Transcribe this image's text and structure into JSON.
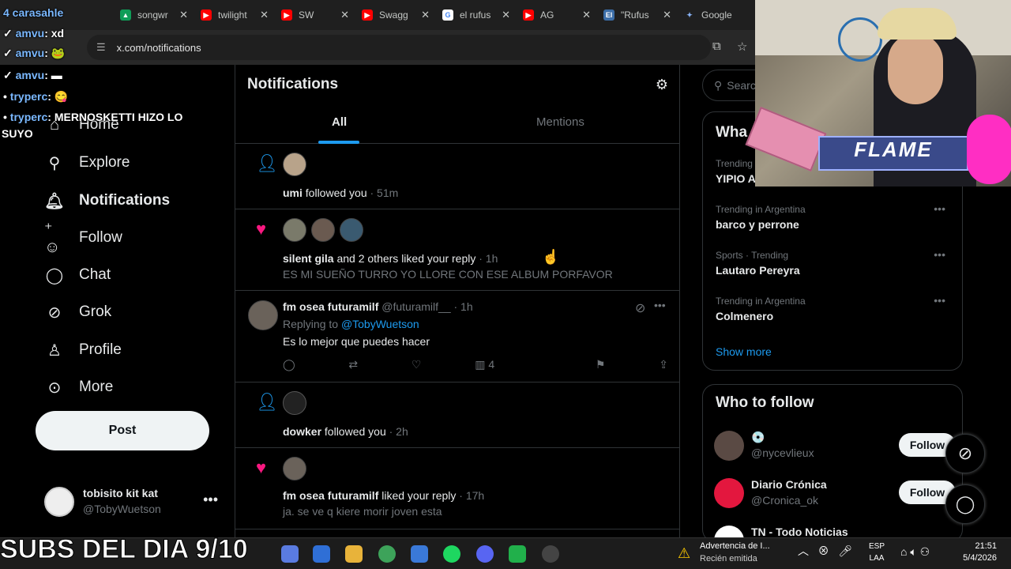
{
  "browser": {
    "tabs": [
      {
        "title": "songwr",
        "icon": "drive-icon",
        "color": "#0f9d58"
      },
      {
        "title": "twilight",
        "icon": "youtube-icon",
        "color": "#ff0000"
      },
      {
        "title": "SW",
        "icon": "youtube-icon",
        "color": "#ff0000"
      },
      {
        "title": "Swagg",
        "icon": "youtube-icon",
        "color": "#ff0000"
      },
      {
        "title": "el rufus",
        "icon": "google-icon",
        "color": "#4285f4"
      },
      {
        "title": "AG",
        "icon": "youtube-icon",
        "color": "#ff0000"
      },
      {
        "title": "\"Rufus",
        "icon": "page-icon",
        "color": "#3c6ea8"
      },
      {
        "title": "Google",
        "icon": "gemini-icon",
        "color": "#8ab4f8"
      }
    ],
    "url": "x.com/notifications"
  },
  "sidebar": {
    "nav": [
      {
        "label": "Home",
        "icon": "home-icon"
      },
      {
        "label": "Explore",
        "icon": "search-icon"
      },
      {
        "label": "Notifications",
        "icon": "bell-icon"
      },
      {
        "label": "Follow",
        "icon": "add-person-icon"
      },
      {
        "label": "Chat",
        "icon": "chat-icon"
      },
      {
        "label": "Grok",
        "icon": "grok-icon"
      },
      {
        "label": "Profile",
        "icon": "person-icon"
      },
      {
        "label": "More",
        "icon": "more-circle-icon"
      }
    ],
    "post_label": "Post",
    "account": {
      "name": "tobisito kit kat",
      "handle": "@TobyWuetson"
    }
  },
  "main": {
    "title": "Notifications",
    "tabs": [
      "All",
      "Mentions"
    ],
    "items": [
      {
        "type": "follow",
        "user": "umi",
        "text": " followed you",
        "time": " · 51m"
      },
      {
        "type": "like",
        "user": "silent gila",
        "text": " and 2 others liked your reply",
        "time": " · 1h",
        "quote": "ES MI SUEÑO TURRO YO LLORE CON ESE ALBUM PORFAVOR"
      },
      {
        "type": "reply",
        "user": "fm osea futuramilf",
        "handle": "@futuramilf__",
        "time": " · 1h",
        "replying_prefix": "Replying to ",
        "replying_to": "@TobyWuetson",
        "text": "Es lo mejor que puedes hacer",
        "views": "4"
      },
      {
        "type": "follow",
        "user": "dowker",
        "text": " followed you",
        "time": " · 2h"
      },
      {
        "type": "like",
        "user": "fm osea futuramilf",
        "text": " liked your reply",
        "time": " · 17h",
        "quote": "ja. se ve q kiere morir joven esta"
      }
    ]
  },
  "right": {
    "search_placeholder": "Searc",
    "trends_title": "Wha",
    "trends": [
      {
        "context": "Trending",
        "name": "YIPIO AL 900"
      },
      {
        "context": "Trending in Argentina",
        "name": "barco y perrone"
      },
      {
        "context": "Sports · Trending",
        "name": "Lautaro Pereyra"
      },
      {
        "context": "Trending in Argentina",
        "name": "Colmenero"
      }
    ],
    "show_more": "Show more",
    "who_to_follow_title": "Who to follow",
    "suggestions": [
      {
        "name": "💿",
        "handle": "@nycevlieux",
        "button": "Follow"
      },
      {
        "name": "Diario Crónica",
        "handle": "@Cronica_ok",
        "button": "Follow"
      },
      {
        "name": "TN - Todo Noticias",
        "handle": "",
        "button": ""
      }
    ]
  },
  "overlay": {
    "chat": [
      {
        "user": "4 carasahle",
        "text": ""
      },
      {
        "user": "amvu",
        "text": ": xd"
      },
      {
        "user": "amvu",
        "text": ":"
      },
      {
        "user": "amvu",
        "text": ":"
      },
      {
        "user": "tryperc",
        "text": ":"
      },
      {
        "user": "tryperc",
        "text": ": MERNOSKETTI HIZO LO"
      },
      {
        "user": "",
        "text": "SUYO"
      }
    ],
    "cam_brand": "FLAME",
    "subs_banner": "SUBS DEL DIA 9/10"
  },
  "taskbar": {
    "notification_title": "Advertencia de I...",
    "notification_sub": "Recién emitida",
    "lang": "ESP",
    "layout": "LAA",
    "time": "21:51",
    "date": "5/4/2026"
  }
}
